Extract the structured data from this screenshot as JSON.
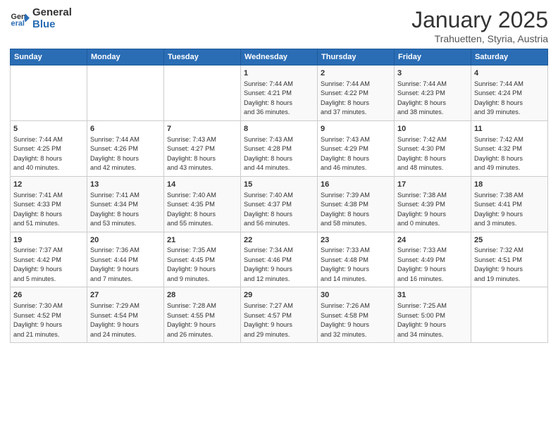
{
  "header": {
    "logo_general": "General",
    "logo_blue": "Blue",
    "month": "January 2025",
    "location": "Trahuetten, Styria, Austria"
  },
  "weekdays": [
    "Sunday",
    "Monday",
    "Tuesday",
    "Wednesday",
    "Thursday",
    "Friday",
    "Saturday"
  ],
  "weeks": [
    [
      {
        "day": "",
        "info": ""
      },
      {
        "day": "",
        "info": ""
      },
      {
        "day": "",
        "info": ""
      },
      {
        "day": "1",
        "info": "Sunrise: 7:44 AM\nSunset: 4:21 PM\nDaylight: 8 hours\nand 36 minutes."
      },
      {
        "day": "2",
        "info": "Sunrise: 7:44 AM\nSunset: 4:22 PM\nDaylight: 8 hours\nand 37 minutes."
      },
      {
        "day": "3",
        "info": "Sunrise: 7:44 AM\nSunset: 4:23 PM\nDaylight: 8 hours\nand 38 minutes."
      },
      {
        "day": "4",
        "info": "Sunrise: 7:44 AM\nSunset: 4:24 PM\nDaylight: 8 hours\nand 39 minutes."
      }
    ],
    [
      {
        "day": "5",
        "info": "Sunrise: 7:44 AM\nSunset: 4:25 PM\nDaylight: 8 hours\nand 40 minutes."
      },
      {
        "day": "6",
        "info": "Sunrise: 7:44 AM\nSunset: 4:26 PM\nDaylight: 8 hours\nand 42 minutes."
      },
      {
        "day": "7",
        "info": "Sunrise: 7:43 AM\nSunset: 4:27 PM\nDaylight: 8 hours\nand 43 minutes."
      },
      {
        "day": "8",
        "info": "Sunrise: 7:43 AM\nSunset: 4:28 PM\nDaylight: 8 hours\nand 44 minutes."
      },
      {
        "day": "9",
        "info": "Sunrise: 7:43 AM\nSunset: 4:29 PM\nDaylight: 8 hours\nand 46 minutes."
      },
      {
        "day": "10",
        "info": "Sunrise: 7:42 AM\nSunset: 4:30 PM\nDaylight: 8 hours\nand 48 minutes."
      },
      {
        "day": "11",
        "info": "Sunrise: 7:42 AM\nSunset: 4:32 PM\nDaylight: 8 hours\nand 49 minutes."
      }
    ],
    [
      {
        "day": "12",
        "info": "Sunrise: 7:41 AM\nSunset: 4:33 PM\nDaylight: 8 hours\nand 51 minutes."
      },
      {
        "day": "13",
        "info": "Sunrise: 7:41 AM\nSunset: 4:34 PM\nDaylight: 8 hours\nand 53 minutes."
      },
      {
        "day": "14",
        "info": "Sunrise: 7:40 AM\nSunset: 4:35 PM\nDaylight: 8 hours\nand 55 minutes."
      },
      {
        "day": "15",
        "info": "Sunrise: 7:40 AM\nSunset: 4:37 PM\nDaylight: 8 hours\nand 56 minutes."
      },
      {
        "day": "16",
        "info": "Sunrise: 7:39 AM\nSunset: 4:38 PM\nDaylight: 8 hours\nand 58 minutes."
      },
      {
        "day": "17",
        "info": "Sunrise: 7:38 AM\nSunset: 4:39 PM\nDaylight: 9 hours\nand 0 minutes."
      },
      {
        "day": "18",
        "info": "Sunrise: 7:38 AM\nSunset: 4:41 PM\nDaylight: 9 hours\nand 3 minutes."
      }
    ],
    [
      {
        "day": "19",
        "info": "Sunrise: 7:37 AM\nSunset: 4:42 PM\nDaylight: 9 hours\nand 5 minutes."
      },
      {
        "day": "20",
        "info": "Sunrise: 7:36 AM\nSunset: 4:44 PM\nDaylight: 9 hours\nand 7 minutes."
      },
      {
        "day": "21",
        "info": "Sunrise: 7:35 AM\nSunset: 4:45 PM\nDaylight: 9 hours\nand 9 minutes."
      },
      {
        "day": "22",
        "info": "Sunrise: 7:34 AM\nSunset: 4:46 PM\nDaylight: 9 hours\nand 12 minutes."
      },
      {
        "day": "23",
        "info": "Sunrise: 7:33 AM\nSunset: 4:48 PM\nDaylight: 9 hours\nand 14 minutes."
      },
      {
        "day": "24",
        "info": "Sunrise: 7:33 AM\nSunset: 4:49 PM\nDaylight: 9 hours\nand 16 minutes."
      },
      {
        "day": "25",
        "info": "Sunrise: 7:32 AM\nSunset: 4:51 PM\nDaylight: 9 hours\nand 19 minutes."
      }
    ],
    [
      {
        "day": "26",
        "info": "Sunrise: 7:30 AM\nSunset: 4:52 PM\nDaylight: 9 hours\nand 21 minutes."
      },
      {
        "day": "27",
        "info": "Sunrise: 7:29 AM\nSunset: 4:54 PM\nDaylight: 9 hours\nand 24 minutes."
      },
      {
        "day": "28",
        "info": "Sunrise: 7:28 AM\nSunset: 4:55 PM\nDaylight: 9 hours\nand 26 minutes."
      },
      {
        "day": "29",
        "info": "Sunrise: 7:27 AM\nSunset: 4:57 PM\nDaylight: 9 hours\nand 29 minutes."
      },
      {
        "day": "30",
        "info": "Sunrise: 7:26 AM\nSunset: 4:58 PM\nDaylight: 9 hours\nand 32 minutes."
      },
      {
        "day": "31",
        "info": "Sunrise: 7:25 AM\nSunset: 5:00 PM\nDaylight: 9 hours\nand 34 minutes."
      },
      {
        "day": "",
        "info": ""
      }
    ]
  ]
}
